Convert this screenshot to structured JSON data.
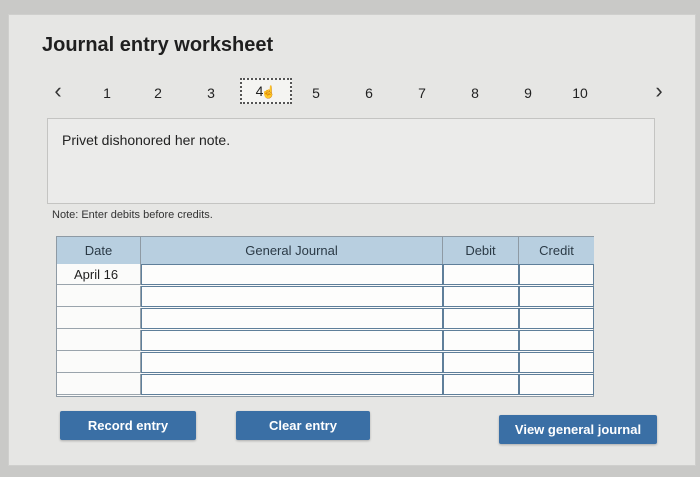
{
  "title": "Journal entry worksheet",
  "pager": {
    "prev_icon": "chevron-left-icon",
    "next_icon": "chevron-right-icon",
    "pages": [
      "1",
      "2",
      "3",
      "4",
      "5",
      "6",
      "7",
      "8",
      "9",
      "10"
    ],
    "active_page": "4"
  },
  "description": "Privet dishonored her note.",
  "note": "Note: Enter debits before credits.",
  "table": {
    "headers": {
      "date": "Date",
      "journal": "General Journal",
      "debit": "Debit",
      "credit": "Credit"
    },
    "rows": [
      {
        "date": "April 16",
        "account": "",
        "debit": "",
        "credit": ""
      },
      {
        "date": "",
        "account": "",
        "debit": "",
        "credit": ""
      },
      {
        "date": "",
        "account": "",
        "debit": "",
        "credit": ""
      },
      {
        "date": "",
        "account": "",
        "debit": "",
        "credit": ""
      },
      {
        "date": "",
        "account": "",
        "debit": "",
        "credit": ""
      },
      {
        "date": "",
        "account": "",
        "debit": "",
        "credit": ""
      }
    ]
  },
  "buttons": {
    "record": "Record entry",
    "clear": "Clear entry",
    "view": "View general journal"
  },
  "colors": {
    "button": "#3a6fa5",
    "header": "#b8cfe0"
  }
}
